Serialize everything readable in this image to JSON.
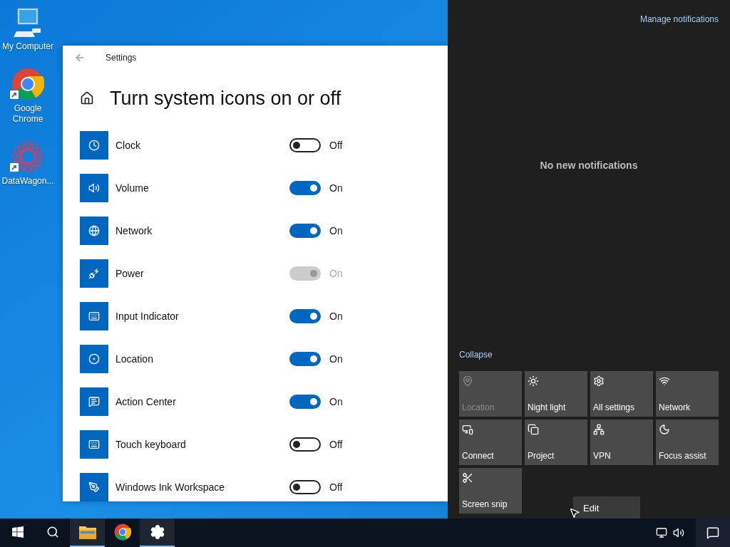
{
  "desktop_icons": [
    {
      "label": "My Computer",
      "shortcut": false
    },
    {
      "label": "Google Chrome",
      "shortcut": true
    },
    {
      "label": "DataWagon...",
      "shortcut": true
    }
  ],
  "settings": {
    "title": "Settings",
    "heading": "Turn system icons on or off",
    "rows": [
      {
        "label": "Clock",
        "on": false,
        "disabled": false,
        "state_text": "Off"
      },
      {
        "label": "Volume",
        "on": true,
        "disabled": false,
        "state_text": "On"
      },
      {
        "label": "Network",
        "on": true,
        "disabled": false,
        "state_text": "On"
      },
      {
        "label": "Power",
        "on": true,
        "disabled": true,
        "state_text": "On"
      },
      {
        "label": "Input Indicator",
        "on": true,
        "disabled": false,
        "state_text": "On"
      },
      {
        "label": "Location",
        "on": true,
        "disabled": false,
        "state_text": "On"
      },
      {
        "label": "Action Center",
        "on": true,
        "disabled": false,
        "state_text": "On"
      },
      {
        "label": "Touch keyboard",
        "on": false,
        "disabled": false,
        "state_text": "Off"
      },
      {
        "label": "Windows Ink Workspace",
        "on": false,
        "disabled": false,
        "state_text": "Off"
      }
    ]
  },
  "action_center": {
    "manage_link": "Manage notifications",
    "empty_message": "No new notifications",
    "collapse_link": "Collapse",
    "tiles": [
      {
        "label": "Location",
        "disabled": true
      },
      {
        "label": "Night light",
        "disabled": false
      },
      {
        "label": "All settings",
        "disabled": false
      },
      {
        "label": "Network",
        "disabled": false
      },
      {
        "label": "Connect",
        "disabled": false
      },
      {
        "label": "Project",
        "disabled": false
      },
      {
        "label": "VPN",
        "disabled": false
      },
      {
        "label": "Focus assist",
        "disabled": false
      },
      {
        "label": "Screen snip",
        "disabled": false
      }
    ],
    "edit_button": "Edit"
  },
  "taskbar": {
    "apps": [
      {
        "running": false
      },
      {
        "running": false
      },
      {
        "running": true
      },
      {
        "running": false
      },
      {
        "running": true
      }
    ]
  }
}
